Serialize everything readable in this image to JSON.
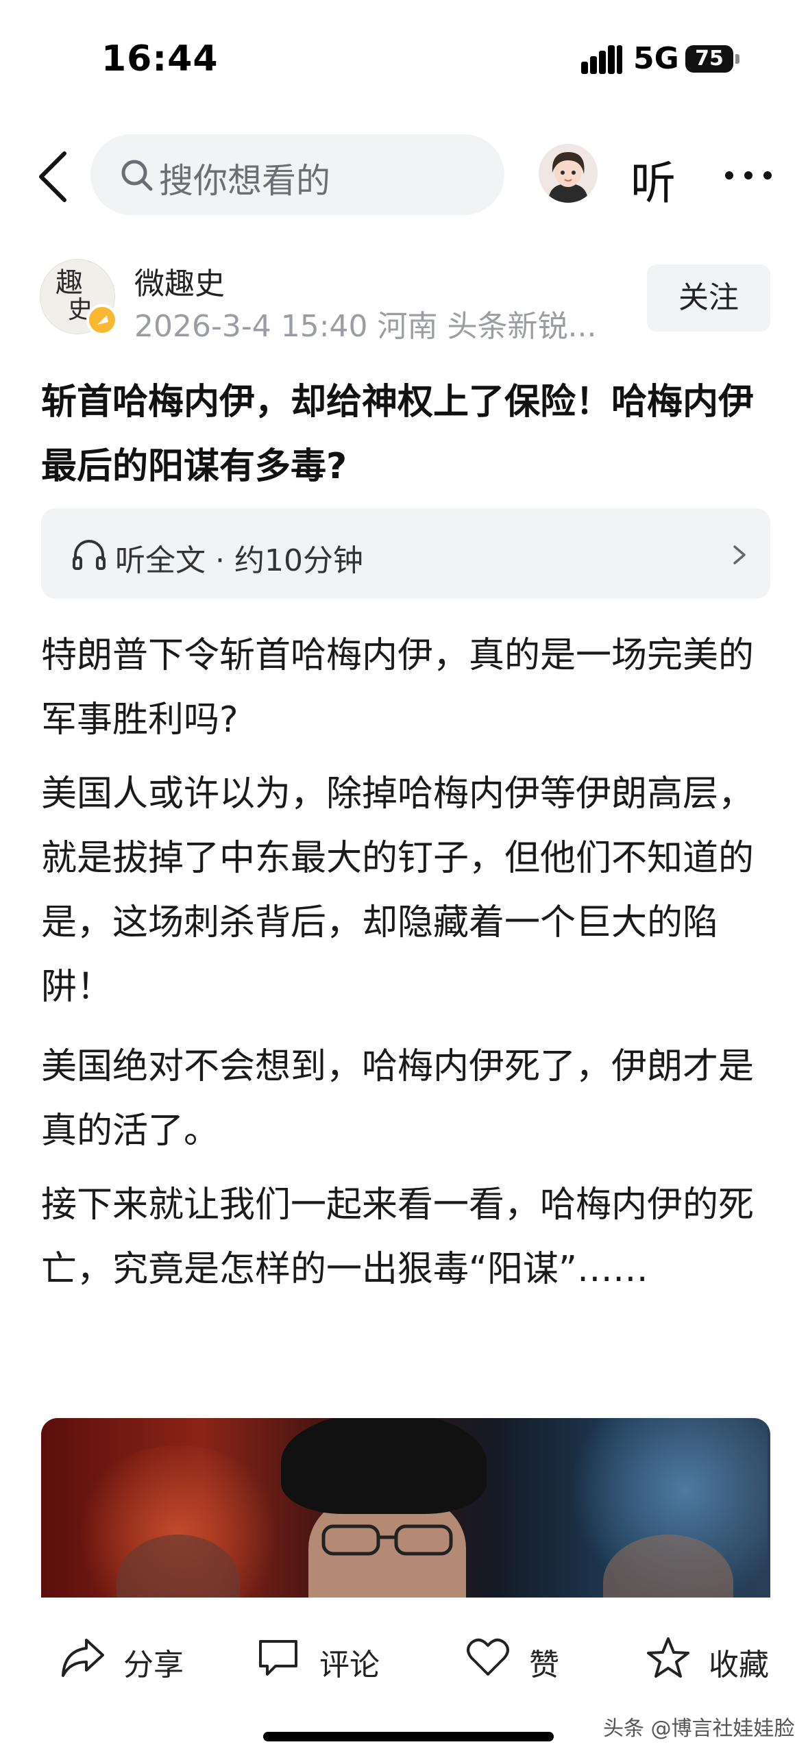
{
  "status_bar": {
    "time": "16:44",
    "network": "5G",
    "battery": "75"
  },
  "nav": {
    "search_placeholder": "搜你想看的",
    "listen_label": "听"
  },
  "author": {
    "name": "微趣史",
    "meta": "2026-3-4 15:40 河南 头条新锐...",
    "avatar_glyph_1": "趣",
    "avatar_glyph_2": "史",
    "follow_label": "关注"
  },
  "article": {
    "title": "斩首哈梅内伊，却给神权上了保险！哈梅内伊最后的阳谋有多毒?",
    "listen_full": "听全文 · 约10分钟",
    "paragraphs": [
      "特朗普下令斩首哈梅内伊，真的是一场完美的军事胜利吗?",
      "美国人或许以为，除掉哈梅内伊等伊朗高层，就是拔掉了中东最大的钉子，但他们不知道的是，这场刺杀背后，却隐藏着一个巨大的陷阱！",
      "美国绝对不会想到，哈梅内伊死了，伊朗才是真的活了。",
      "接下来就让我们一起来看一看，哈梅内伊的死亡，究竟是怎样的一出狠毒“阳谋”……"
    ]
  },
  "toolbar": {
    "share": "分享",
    "comment": "评论",
    "like": "赞",
    "favorite": "收藏"
  },
  "watermark": "头条 @博言社娃娃脸",
  "colors": {
    "secondary_text": "#9a9da3",
    "pill_bg": "#f2f3f5",
    "badge": "#fcb731"
  }
}
